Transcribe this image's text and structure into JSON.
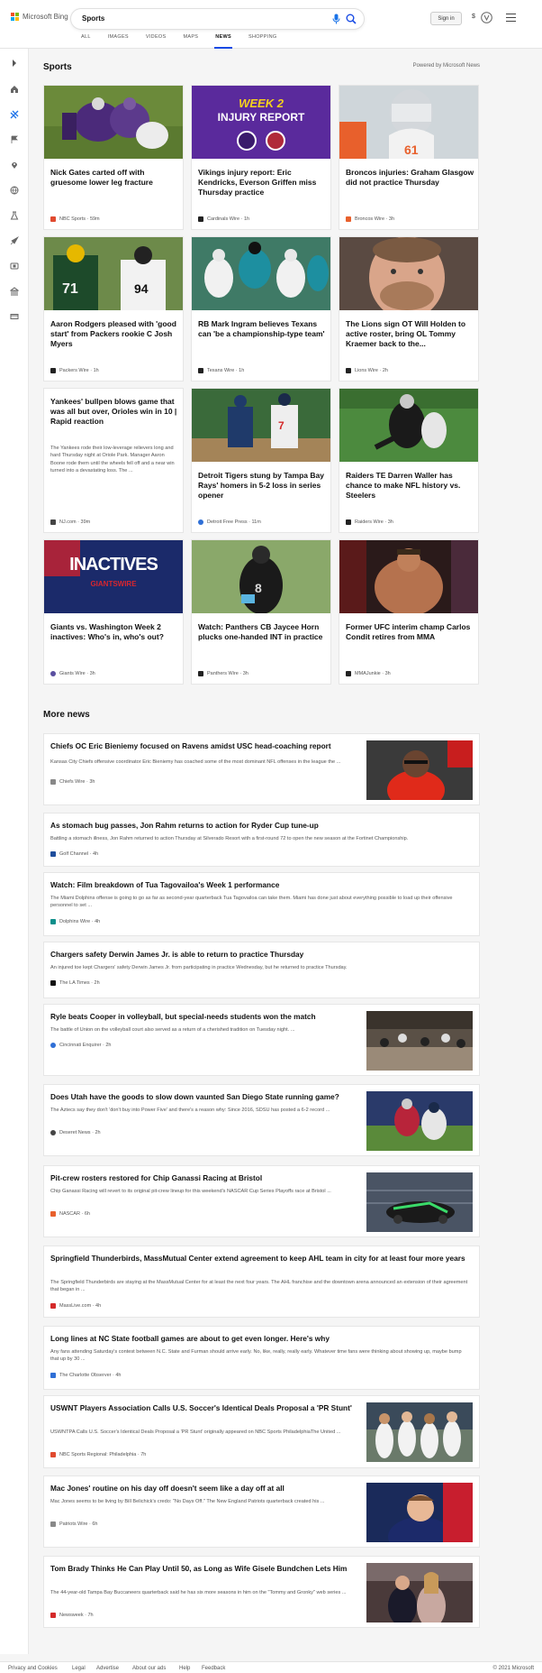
{
  "header": {
    "logo_text": "Microsoft Bing",
    "search_value": "Sports",
    "sign_in": "Sign in",
    "currency": "$",
    "tabs": [
      "ALL",
      "IMAGES",
      "VIDEOS",
      "MAPS",
      "NEWS",
      "SHOPPING"
    ],
    "active_tab": "NEWS"
  },
  "section": {
    "title": "Sports",
    "powered_by": "Powered by Microsoft News"
  },
  "cards": [
    {
      "title": "Nick Gates carted off with gruesome lower leg fracture",
      "source": "NBC Sports",
      "time": "59m",
      "logo_color": "#e04a2f"
    },
    {
      "title": "Vikings injury report: Eric Kendricks, Everson Griffen miss Thursday practice",
      "source": "Cardinals Wire",
      "time": "1h",
      "logo_color": "#222222",
      "image_text_top": "WEEK 2",
      "image_text_bottom": "INJURY REPORT"
    },
    {
      "title": "Broncos injuries: Graham Glasgow did not practice Thursday",
      "source": "Broncos Wire",
      "time": "3h",
      "logo_color": "#e8602c"
    },
    {
      "title": "Aaron Rodgers pleased with 'good start' from Packers rookie C Josh Myers",
      "source": "Packers Wire",
      "time": "1h",
      "logo_color": "#222222"
    },
    {
      "title": "RB Mark Ingram believes Texans can 'be a championship-type team'",
      "source": "Texans Wire",
      "time": "1h",
      "logo_color": "#222222"
    },
    {
      "title": "The Lions sign OT Will Holden to active roster, bring OL Tommy Kraemer back to the...",
      "source": "Lions Wire",
      "time": "2h",
      "logo_color": "#222222"
    },
    {
      "title": "Yankees' bullpen blows game that was all but over, Orioles win in 10 | Rapid reaction",
      "snippet": "The Yankees rode their low-leverage relievers long and hard Thursday night at Oriole Park. Manager Aaron Boone rode them until the wheels fell off and a near win turned into a devastating loss. The ...",
      "source": "NJ.com",
      "time": "39m",
      "logo_color": "#444444"
    },
    {
      "title": "Detroit Tigers stung by Tampa Bay Rays' homers in 5-2 loss in series opener",
      "source": "Detroit Free Press",
      "time": "11m",
      "logo_color": "#2f6fd6"
    },
    {
      "title": "Raiders TE Darren Waller has chance to make NFL history vs. Steelers",
      "source": "Raiders Wire",
      "time": "3h",
      "logo_color": "#222222"
    },
    {
      "title": "Giants vs. Washington Week 2 inactives: Who's in, who's out?",
      "source": "Giants Wire",
      "time": "3h",
      "logo_color": "#5a4fa0",
      "image_text_top": "INACTIVES",
      "image_text_bottom": "GIANTSWIRE"
    },
    {
      "title": "Watch: Panthers CB Jaycee Horn plucks one-handed INT in practice",
      "source": "Panthers Wire",
      "time": "3h",
      "logo_color": "#222222"
    },
    {
      "title": "Former UFC interim champ Carlos Condit retires from MMA",
      "source": "MMAJunkie",
      "time": "3h",
      "logo_color": "#222222"
    }
  ],
  "more_news_title": "More news",
  "more_news": [
    {
      "title": "Chiefs OC Eric Bieniemy focused on Ravens amidst USC head-coaching report",
      "snippet": "Kansas City Chiefs offensive coordinator Eric Bieniemy has coached some of the most dominant NFL offenses in the league the ...",
      "source": "Chiefs Wire",
      "time": "3h",
      "logo_color": "#888888"
    },
    {
      "title": "As stomach bug passes, Jon Rahm returns to action for Ryder Cup tune-up",
      "snippet": "Battling a stomach illness, Jon Rahm returned to action Thursday at Silverado Resort with a first-round 72 to open the new season at the Fortinet Championship.",
      "source": "Golf Channel",
      "time": "4h",
      "logo_color": "#1f4e9c"
    },
    {
      "title": "Watch: Film breakdown of Tua Tagovailoa's Week 1 performance",
      "snippet": "The Miami Dolphins offense is going to go as far as second-year quarterback Tua Tagovailoa can take them. Miami has done just about everything possible to load up their offensive personnel to set ...",
      "source": "Dolphins Wire",
      "time": "4h",
      "logo_color": "#0e8f8b"
    },
    {
      "title": "Chargers safety Derwin James Jr. is able to return to practice Thursday",
      "snippet": "An injured toe kept Chargers' safety Derwin James Jr. from participating in practice Wednesday, but he returned to practice Thursday.",
      "source": "The LA Times",
      "time": "2h",
      "logo_color": "#111111"
    },
    {
      "title": "Ryle beats Cooper in volleyball, but special-needs students won the match",
      "snippet": "The battle of Union on the volleyball court also served as a return of a cherished tradition on Tuesday night. ...",
      "source": "Cincinnati Enquirer",
      "time": "2h",
      "logo_color": "#2f6fd6"
    },
    {
      "title": "Does Utah have the goods to slow down vaunted San Diego State running game?",
      "snippet": "The Aztecs say they don't 'don't buy into Power Five' and there's a reason why: Since 2016, SDSU has posted a 6-2 record ...",
      "source": "Deseret News",
      "time": "2h",
      "logo_color": "#444444"
    },
    {
      "title": "Pit-crew rosters restored for Chip Ganassi Racing at Bristol",
      "snippet": "Chip Ganassi Racing will revert to its original pit-crew lineup for this weekend's NASCAR Cup Series Playoffs race at Bristol ...",
      "source": "NASCAR",
      "time": "6h",
      "logo_color": "#e8602c"
    },
    {
      "title": "Springfield Thunderbirds, MassMutual Center extend agreement to keep AHL team in city for at least four more years",
      "snippet": "The Springfield Thunderbirds are staying at the MassMutual Center for at least the next four years. The AHL franchise and the downtown arena announced an extension of their agreement that began in ...",
      "source": "MassLive.com",
      "time": "4h",
      "logo_color": "#d42a2a"
    },
    {
      "title": "Long lines at NC State football games are about to get even longer. Here's why",
      "snippet": "Any fans attending Saturday's contest between N.C. State and Furman should arrive early. No, like, really, really early. Whatever time fans were thinking about showing up, maybe bump that up by 30 ...",
      "source": "The Charlotte Observer",
      "time": "4h",
      "logo_color": "#2f6fd6"
    },
    {
      "title": "USWNT Players Association Calls U.S. Soccer's Identical Deals Proposal a 'PR Stunt'",
      "snippet": "USWNTPA Calls U.S. Soccer's Identical Deals Proposal a 'PR Stunt' originally appeared on NBC Sports PhiladelphiaThe United ...",
      "source": "NBC Sports Regional: Philadelphia",
      "time": "7h",
      "logo_color": "#e04a2f"
    },
    {
      "title": "Mac Jones' routine on his day off doesn't seem like a day off at all",
      "snippet": "Mac Jones seems to be living by Bill Belichick's credo: \"No Days Off.\" The New England Patriots quarterback created his ...",
      "source": "Patriots Wire",
      "time": "6h",
      "logo_color": "#888888"
    },
    {
      "title": "Tom Brady Thinks He Can Play Until 50, as Long as Wife Gisele Bundchen Lets Him",
      "snippet": "The 44-year-old Tampa Bay Buccaneers quarterback said he has six more seasons in him on the \"Tommy and Gronky\" web series ...",
      "source": "Newsweek",
      "time": "7h",
      "logo_color": "#d42a2a"
    }
  ],
  "footer": {
    "links": [
      "Privacy and Cookies",
      "Legal",
      "Advertise",
      "About our ads",
      "Help",
      "Feedback"
    ],
    "copyright": "© 2021 Microsoft"
  }
}
